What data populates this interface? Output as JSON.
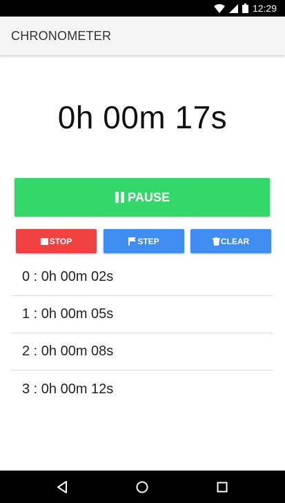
{
  "status_bar": {
    "time": "12:29",
    "icons": [
      "wifi-icon",
      "cell-signal-icon",
      "battery-icon"
    ]
  },
  "app_bar": {
    "title": "CHRONOMETER"
  },
  "timer": {
    "display": "0h 00m 17s"
  },
  "buttons": {
    "pause": {
      "label": "PAUSE",
      "icon": "pause-icon",
      "color": "#34d86a"
    },
    "stop": {
      "label": "STOP",
      "icon": "stop-icon",
      "color": "#f24141"
    },
    "step": {
      "label": "STEP",
      "icon": "flag-icon",
      "color": "#3f8cf2"
    },
    "clear": {
      "label": "CLEAR",
      "icon": "trash-icon",
      "color": "#3f8cf2"
    }
  },
  "laps": [
    {
      "text": "0 : 0h 00m 02s"
    },
    {
      "text": "1 : 0h 00m 05s"
    },
    {
      "text": "2 : 0h 00m 08s"
    },
    {
      "text": "3 : 0h 00m 12s"
    }
  ],
  "nav_bar": {
    "icons": [
      "back-icon",
      "home-icon",
      "recents-icon"
    ]
  }
}
